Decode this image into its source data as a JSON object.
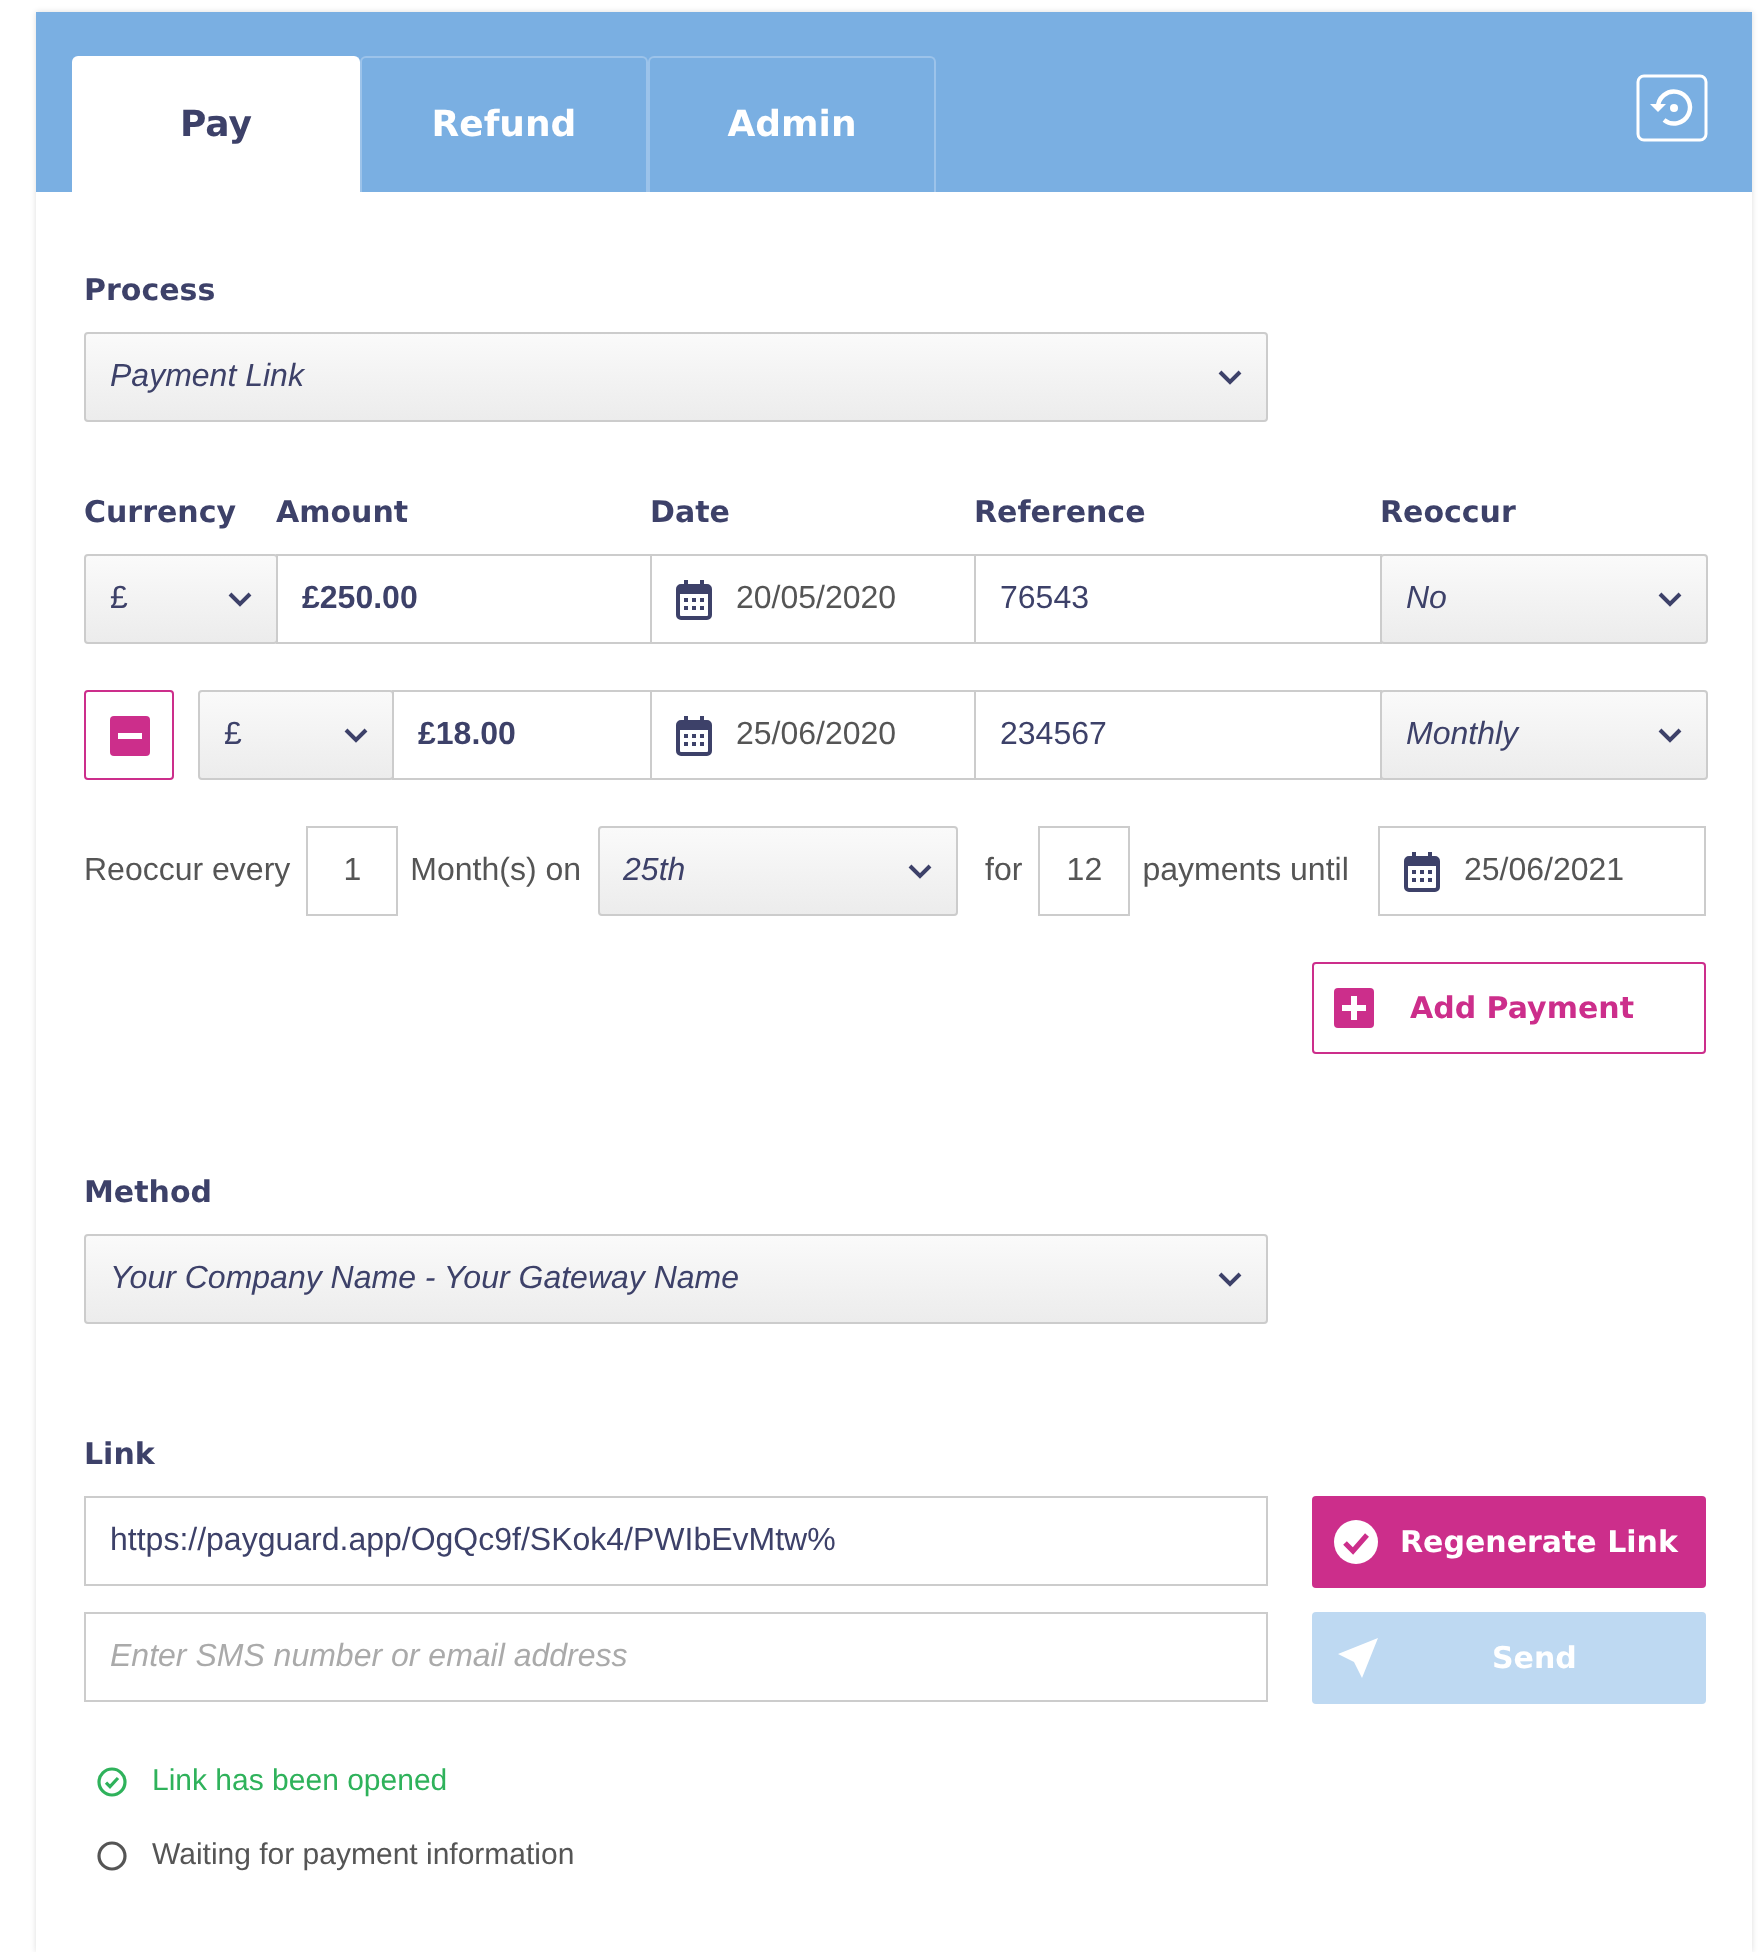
{
  "tabs": [
    {
      "label": "Pay",
      "selected": true
    },
    {
      "label": "Refund",
      "selected": false
    },
    {
      "label": "Admin",
      "selected": false
    }
  ],
  "process": {
    "label": "Process",
    "value": "Payment Link"
  },
  "columns": [
    "Currency",
    "Amount",
    "Date",
    "Reference",
    "Reoccur"
  ],
  "payments": [
    {
      "removable": false,
      "currency": "£",
      "amount": "£250.00",
      "date": "20/05/2020",
      "reference": "76543",
      "reoccur": "No"
    },
    {
      "removable": true,
      "currency": "£",
      "amount": "£18.00",
      "date": "25/06/2020",
      "reference": "234567",
      "reoccur": "Monthly",
      "recurrence": {
        "every_label": "Reoccur every",
        "every": "1",
        "unit_label": "Month(s) on",
        "day": "25th",
        "for_label": "for",
        "count": "12",
        "until_label": "payments until",
        "until": "25/06/2021"
      }
    }
  ],
  "add_payment": "Add Payment",
  "method": {
    "label": "Method",
    "value": "Your Company Name - Your Gateway Name"
  },
  "link": {
    "label": "Link",
    "value": "https://payguard.app/OgQc9f/SKok4/PWIbEvMtw%",
    "regenerate": "Regenerate Link",
    "placeholder": "Enter SMS number or email address",
    "send": "Send",
    "send_disabled": true
  },
  "statuses": [
    {
      "text": "Link has been opened",
      "done": true
    },
    {
      "text": "Waiting for payment information",
      "done": false
    }
  ]
}
